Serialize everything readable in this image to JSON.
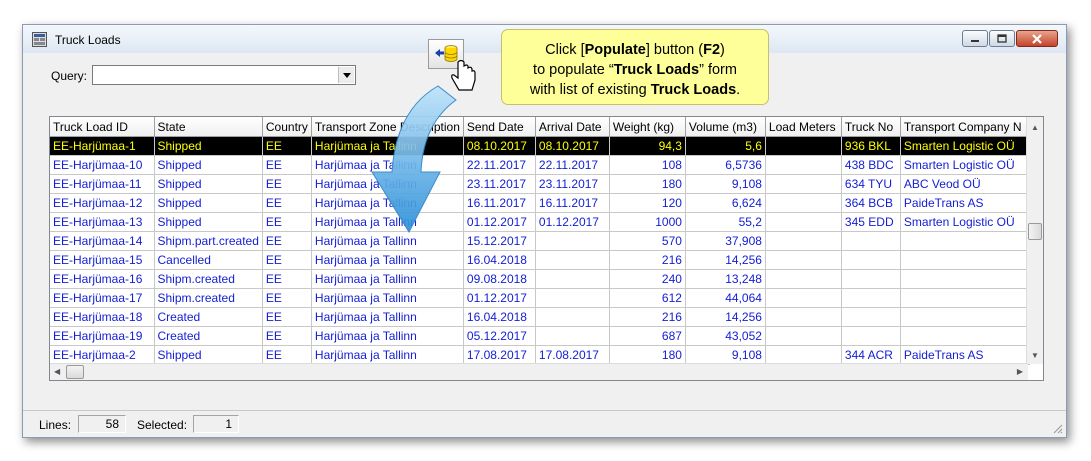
{
  "window": {
    "title": "Truck Loads",
    "controls": {
      "minimize": "minimize-icon",
      "maximize": "maximize-icon",
      "close": "close-icon"
    }
  },
  "query": {
    "label": "Query:",
    "value": ""
  },
  "callout": {
    "part1": "Click [",
    "populate": "Populate",
    "part2": "] button (",
    "f2": "F2",
    "part3": ")",
    "line2a": "to populate “",
    "truck_loads": "Truck Loads",
    "line2b": "” form",
    "line3a": "with list of existing ",
    "truck_loads2": "Truck Loads",
    "line3b": "."
  },
  "grid": {
    "columns": [
      "Truck Load ID",
      "State",
      "Country",
      "Transport Zone Description",
      "Send Date",
      "Arrival Date",
      "Weight (kg)",
      "Volume (m3)",
      "Load Meters",
      "Truck No",
      "Transport Company N"
    ],
    "rows": [
      [
        "EE-Harjümaa-1",
        "Shipped",
        "EE",
        "Harjümaa ja Tallinn",
        "08.10.2017",
        "08.10.2017",
        "94,3",
        "5,6",
        "",
        "936 BKL",
        "Smarten Logistic OÜ"
      ],
      [
        "EE-Harjümaa-10",
        "Shipped",
        "EE",
        "Harjümaa ja Tallinn",
        "22.11.2017",
        "22.11.2017",
        "108",
        "6,5736",
        "",
        "438 BDC",
        "Smarten Logistic OÜ"
      ],
      [
        "EE-Harjümaa-11",
        "Shipped",
        "EE",
        "Harjümaa ja Tallinn",
        "23.11.2017",
        "23.11.2017",
        "180",
        "9,108",
        "",
        "634 TYU",
        "ABC Veod OÜ"
      ],
      [
        "EE-Harjümaa-12",
        "Shipped",
        "EE",
        "Harjümaa ja Tallinn",
        "16.11.2017",
        "16.11.2017",
        "120",
        "6,624",
        "",
        "364 BCB",
        "PaideTrans AS"
      ],
      [
        "EE-Harjümaa-13",
        "Shipped",
        "EE",
        "Harjümaa ja Tallinn",
        "01.12.2017",
        "01.12.2017",
        "1000",
        "55,2",
        "",
        "345 EDD",
        "Smarten Logistic OÜ"
      ],
      [
        "EE-Harjümaa-14",
        "Shipm.part.created",
        "EE",
        "Harjümaa ja Tallinn",
        "15.12.2017",
        "",
        "570",
        "37,908",
        "",
        "",
        ""
      ],
      [
        "EE-Harjümaa-15",
        "Cancelled",
        "EE",
        "Harjümaa ja Tallinn",
        "16.04.2018",
        "",
        "216",
        "14,256",
        "",
        "",
        ""
      ],
      [
        "EE-Harjümaa-16",
        "Shipm.created",
        "EE",
        "Harjümaa ja Tallinn",
        "09.08.2018",
        "",
        "240",
        "13,248",
        "",
        "",
        ""
      ],
      [
        "EE-Harjümaa-17",
        "Shipm.created",
        "EE",
        "Harjümaa ja Tallinn",
        "01.12.2017",
        "",
        "612",
        "44,064",
        "",
        "",
        ""
      ],
      [
        "EE-Harjümaa-18",
        "Created",
        "EE",
        "Harjümaa ja Tallinn",
        "16.04.2018",
        "",
        "216",
        "14,256",
        "",
        "",
        ""
      ],
      [
        "EE-Harjümaa-19",
        "Created",
        "EE",
        "Harjümaa ja Tallinn",
        "05.12.2017",
        "",
        "687",
        "43,052",
        "",
        "",
        ""
      ],
      [
        "EE-Harjümaa-2",
        "Shipped",
        "EE",
        "Harjümaa ja Tallinn",
        "17.08.2017",
        "17.08.2017",
        "180",
        "9,108",
        "",
        "344 ACR",
        "PaideTrans AS"
      ]
    ],
    "selected_row": 0,
    "right_aligned_columns": [
      6,
      7
    ]
  },
  "status": {
    "lines_label": "Lines:",
    "lines": "58",
    "selected_label": "Selected:",
    "selected": "1"
  },
  "colors": {
    "row_text": "#1520d4",
    "selected_bg": "#000000",
    "selected_text": "#ffff00",
    "callout_bg": "#ffff99",
    "arrow": "#3aa4e4"
  },
  "icons": {
    "app": "app-window-icon",
    "populate": "populate-icon",
    "cursor": "hand-cursor-icon",
    "arrow": "curved-arrow-icon"
  }
}
